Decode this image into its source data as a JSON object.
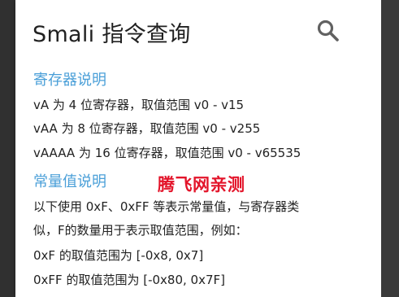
{
  "app": {
    "title": "Smali 指令查询",
    "search_icon": "search-icon"
  },
  "registers": {
    "heading": "寄存器说明",
    "lines": [
      "vA 为 4 位寄存器，取值范围 v0 - v15",
      "vAA 为 8 位寄存器，取值范围 v0 - v255",
      "vAAAA 为 16 位寄存器，取值范围 v0 - v65535"
    ]
  },
  "constants": {
    "heading": "常量值说明",
    "lines": [
      "以下使用 0xF、0xFF 等表示常量值，与寄存器类",
      "似，F的数量用于表示取值范围，例如：",
      "0xF 的取值范围为 [-0x8, 0x7]",
      "0xFF 的取值范围为 [-0x80, 0x7F]"
    ]
  },
  "watermark": "腾飞网亲测",
  "colors": {
    "accent": "#4a9fd8",
    "watermark": "#e3142a"
  }
}
